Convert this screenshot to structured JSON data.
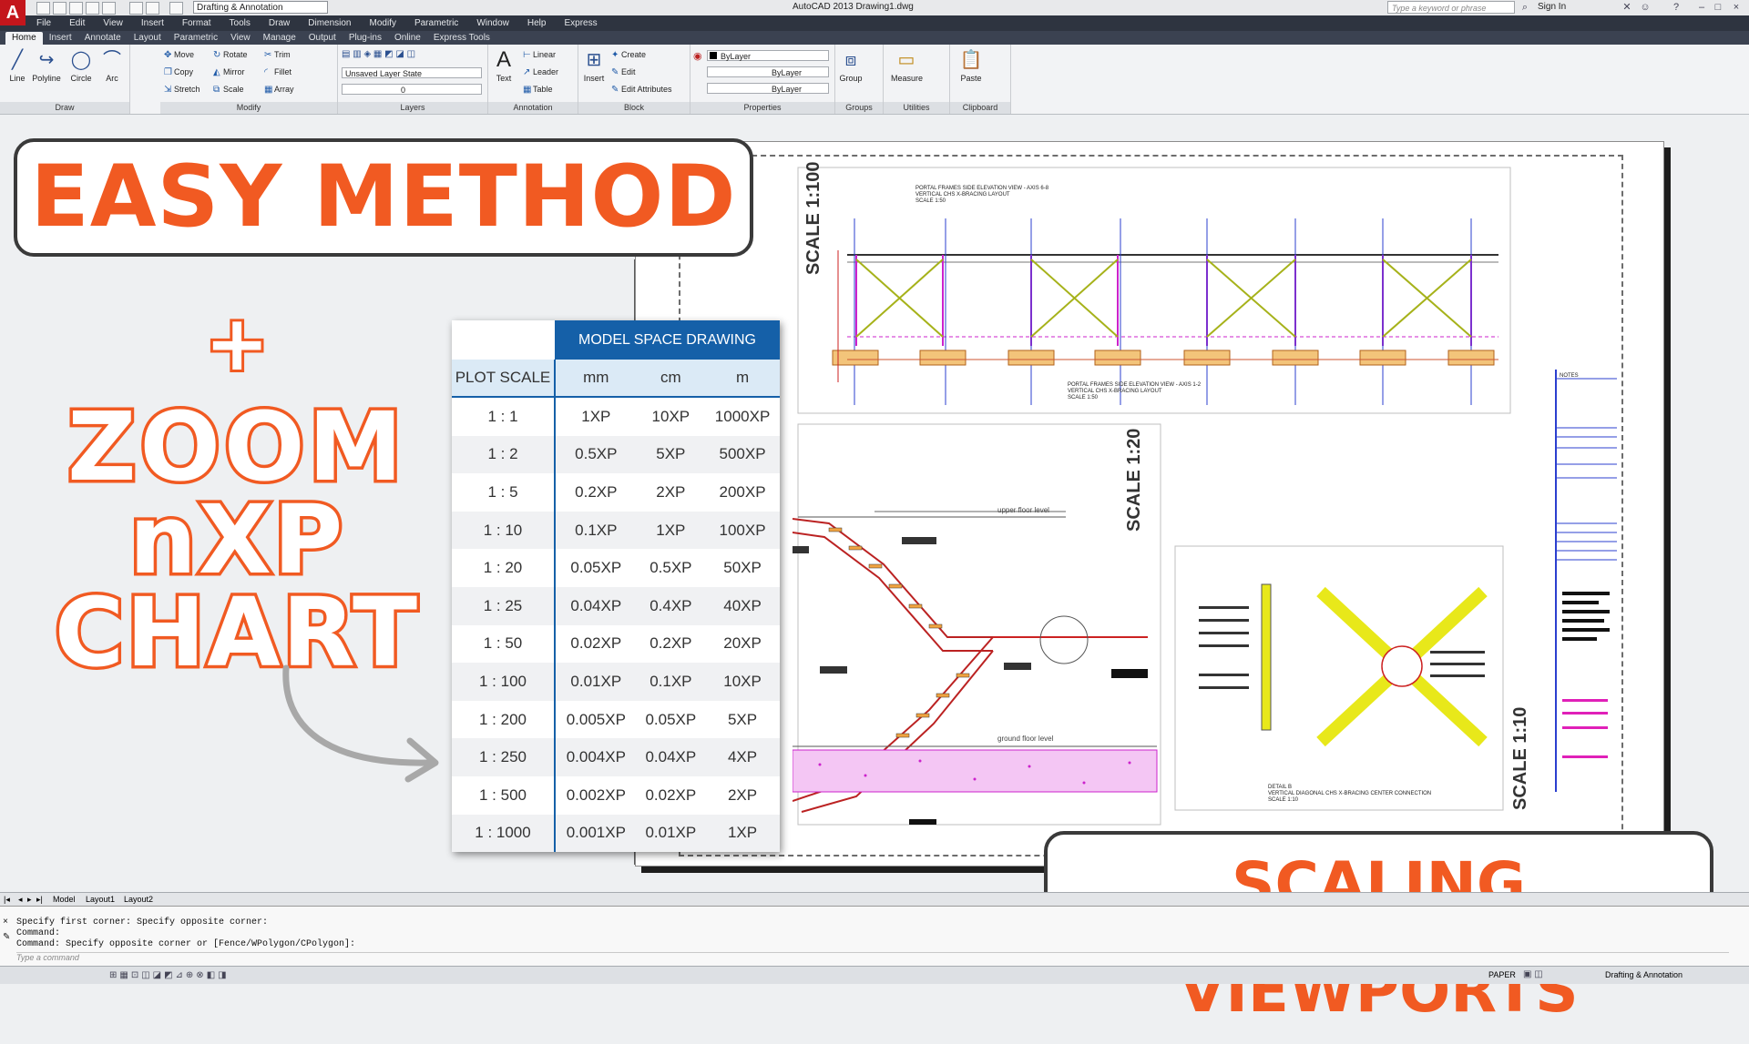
{
  "titlebar": {
    "workspace": "Drafting & Annotation",
    "title": "AutoCAD 2013    Drawing1.dwg",
    "search_placeholder": "Type a keyword or phrase",
    "sign_in": "Sign In"
  },
  "menu": [
    "File",
    "Edit",
    "View",
    "Insert",
    "Format",
    "Tools",
    "Draw",
    "Dimension",
    "Modify",
    "Parametric",
    "Window",
    "Help",
    "Express"
  ],
  "ribbon_tabs": [
    "Home",
    "Insert",
    "Annotate",
    "Layout",
    "Parametric",
    "View",
    "Manage",
    "Output",
    "Plug-ins",
    "Online",
    "Express Tools"
  ],
  "ribbon": {
    "draw": {
      "title": "Draw",
      "line": "Line",
      "polyline": "Polyline",
      "circle": "Circle",
      "arc": "Arc"
    },
    "modify": {
      "title": "Modify",
      "move": "Move",
      "rotate": "Rotate",
      "trim": "Trim",
      "copy": "Copy",
      "mirror": "Mirror",
      "fillet": "Fillet",
      "stretch": "Stretch",
      "scale": "Scale",
      "array": "Array"
    },
    "layers": {
      "title": "Layers",
      "state": "Unsaved Layer State",
      "current": "0"
    },
    "annotation": {
      "title": "Annotation",
      "text": "Text",
      "linear": "Linear",
      "leader": "Leader",
      "table": "Table"
    },
    "block": {
      "title": "Block",
      "insert": "Insert",
      "create": "Create",
      "edit": "Edit",
      "edit_attributes": "Edit Attributes"
    },
    "properties": {
      "title": "Properties",
      "color": "ByLayer",
      "linetype": "ByLayer",
      "lineweight": "ByLayer"
    },
    "groups": {
      "title": "Groups",
      "group": "Group"
    },
    "utilities": {
      "title": "Utilities",
      "measure": "Measure"
    },
    "clipboard": {
      "title": "Clipboard",
      "paste": "Paste"
    }
  },
  "overlay": {
    "easy_method": "EASY METHOD",
    "plus": "+",
    "zoom": "ZOOM",
    "nxp": "nXP",
    "chart": "CHART",
    "scaling_viewports": "SCALING VIEWPORTS"
  },
  "table": {
    "group_header": "MODEL SPACE DRAWING",
    "plot_scale": "PLOT SCALE",
    "units": [
      "mm",
      "cm",
      "m"
    ],
    "rows": [
      [
        "1 : 1",
        "1XP",
        "10XP",
        "1000XP"
      ],
      [
        "1 : 2",
        "0.5XP",
        "5XP",
        "500XP"
      ],
      [
        "1 : 5",
        "0.2XP",
        "2XP",
        "200XP"
      ],
      [
        "1 : 10",
        "0.1XP",
        "1XP",
        "100XP"
      ],
      [
        "1 : 20",
        "0.05XP",
        "0.5XP",
        "50XP"
      ],
      [
        "1 : 25",
        "0.04XP",
        "0.4XP",
        "40XP"
      ],
      [
        "1 : 50",
        "0.02XP",
        "0.2XP",
        "20XP"
      ],
      [
        "1 : 100",
        "0.01XP",
        "0.1XP",
        "10XP"
      ],
      [
        "1 : 200",
        "0.005XP",
        "0.05XP",
        "5XP"
      ],
      [
        "1 : 250",
        "0.004XP",
        "0.04XP",
        "4XP"
      ],
      [
        "1 : 500",
        "0.002XP",
        "0.02XP",
        "2XP"
      ],
      [
        "1 : 1000",
        "0.001XP",
        "0.01XP",
        "1XP"
      ]
    ]
  },
  "drawing": {
    "scale_100": "SCALE 1:100",
    "scale_20": "SCALE 1:20",
    "scale_10": "SCALE 1:10",
    "upper_floor": "upper floor level",
    "ground_floor": "ground floor level",
    "elev_title_1": "PORTAL FRAMES SIDE ELEVATION VIEW - AXIS 6-8",
    "elev_sub_1": "VERTICAL CHS X-BRACING LAYOUT",
    "elev_scale_1": "SCALE 1:50",
    "elev_title_2": "PORTAL FRAMES SIDE ELEVATION VIEW - AXIS 1-2",
    "elev_sub_2": "VERTICAL CHS X-BRACING LAYOUT",
    "elev_scale_2": "SCALE 1:50",
    "detail_title": "DETAIL B",
    "detail_sub": "VERTICAL DIAGONAL CHS X-BRACING CENTER CONNECTION",
    "detail_scale": "SCALE 1:10",
    "notes": "NOTES"
  },
  "layout_tabs": [
    "Model",
    "Layout1",
    "Layout2"
  ],
  "command": {
    "line1": "Specify first corner: Specify opposite corner:",
    "line2": "Command:",
    "line3": "Command: Specify opposite corner or [Fence/WPolygon/CPolygon]:",
    "placeholder": "Type a command"
  },
  "status": {
    "paper": "PAPER",
    "workspace": "Drafting & Annotation"
  },
  "colors": {
    "accent": "#f15a22",
    "table_header": "#1560a8",
    "table_units": "#dbeaf6"
  }
}
